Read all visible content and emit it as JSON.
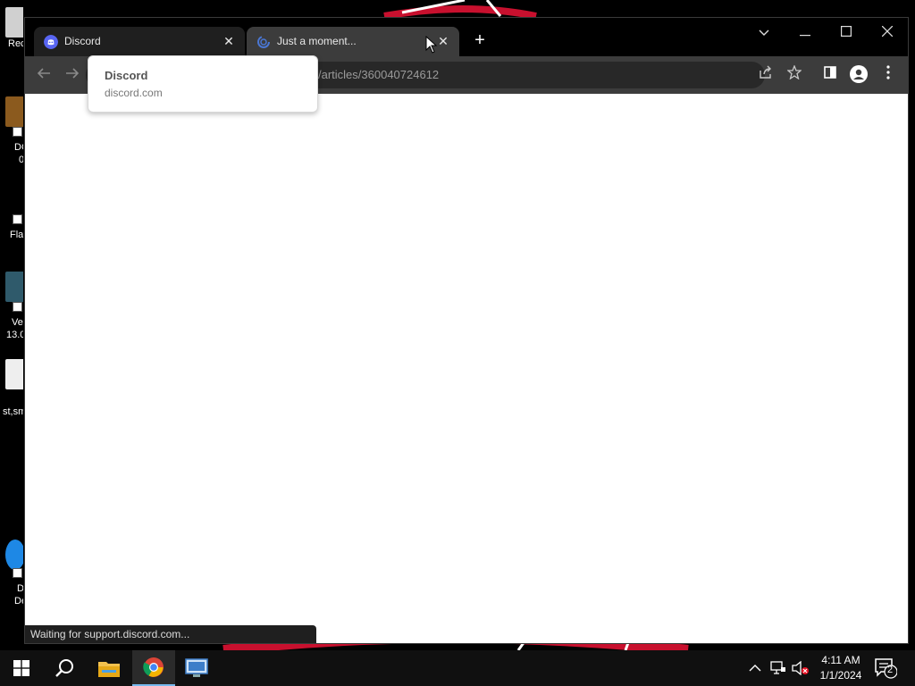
{
  "desktop": {
    "icons": [
      {
        "label": "Rec"
      },
      {
        "label": "DC"
      },
      {
        "label": "0"
      },
      {
        "label": "Fla"
      },
      {
        "label": "Ve"
      },
      {
        "label": "13.0"
      },
      {
        "label": "st,sm"
      },
      {
        "label": "D"
      },
      {
        "label": "De"
      }
    ]
  },
  "browser": {
    "tabs": [
      {
        "title": "Discord",
        "favicon": "discord-icon",
        "active": false
      },
      {
        "title": "Just a moment...",
        "favicon": "loading-spinner-icon",
        "active": true
      }
    ],
    "new_tab_label": "+",
    "window_controls": {
      "tab_search": "⌵",
      "minimize": "—",
      "maximize": "☐",
      "close": "✕"
    },
    "url": "/articles/360040724612",
    "tooltip": {
      "title": "Discord",
      "domain": "discord.com"
    },
    "status": "Waiting for support.discord.com..."
  },
  "taskbar": {
    "clock_time": "4:11 AM",
    "clock_date": "1/1/2024",
    "notification_count": "2",
    "apps": [
      "windows-start-icon",
      "search-icon",
      "file-explorer-icon",
      "chrome-icon",
      "remote-desktop-icon"
    ]
  },
  "colors": {
    "tab_bar": "#000000",
    "active_tab": "#3c3c3c",
    "toolbar": "#3c3c3c",
    "taskbar": "#101010",
    "discord_blurple": "#5865f2"
  }
}
